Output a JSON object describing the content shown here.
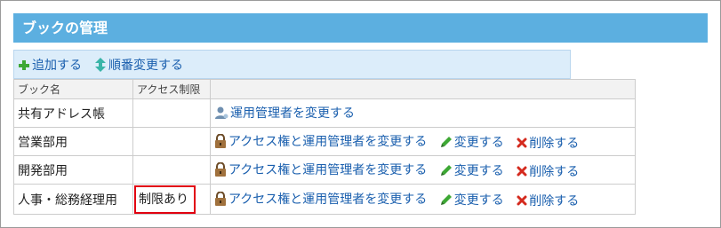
{
  "panel": {
    "title": "ブックの管理"
  },
  "toolbar": {
    "add_label": "追加する",
    "reorder_label": "順番変更する"
  },
  "table": {
    "headers": [
      "ブック名",
      "アクセス制限",
      ""
    ],
    "rows": [
      {
        "name": "共有アドレス帳",
        "access": "",
        "actions": {
          "change_admin": "運用管理者を変更する"
        }
      },
      {
        "name": "営業部用",
        "access": "",
        "actions": {
          "change_access": "アクセス権と運用管理者を変更する",
          "edit": "変更する",
          "delete": "削除する"
        }
      },
      {
        "name": "開発部用",
        "access": "",
        "actions": {
          "change_access": "アクセス権と運用管理者を変更する",
          "edit": "変更する",
          "delete": "削除する"
        }
      },
      {
        "name": "人事・総務経理用",
        "access": "制限あり",
        "actions": {
          "change_access": "アクセス権と運用管理者を変更する",
          "edit": "変更する",
          "delete": "削除する"
        }
      }
    ]
  },
  "colors": {
    "header_bg": "#5cafe0",
    "toolbar_bg": "#dcedfa",
    "link": "#1a5fae",
    "highlight_border": "#e10010"
  }
}
